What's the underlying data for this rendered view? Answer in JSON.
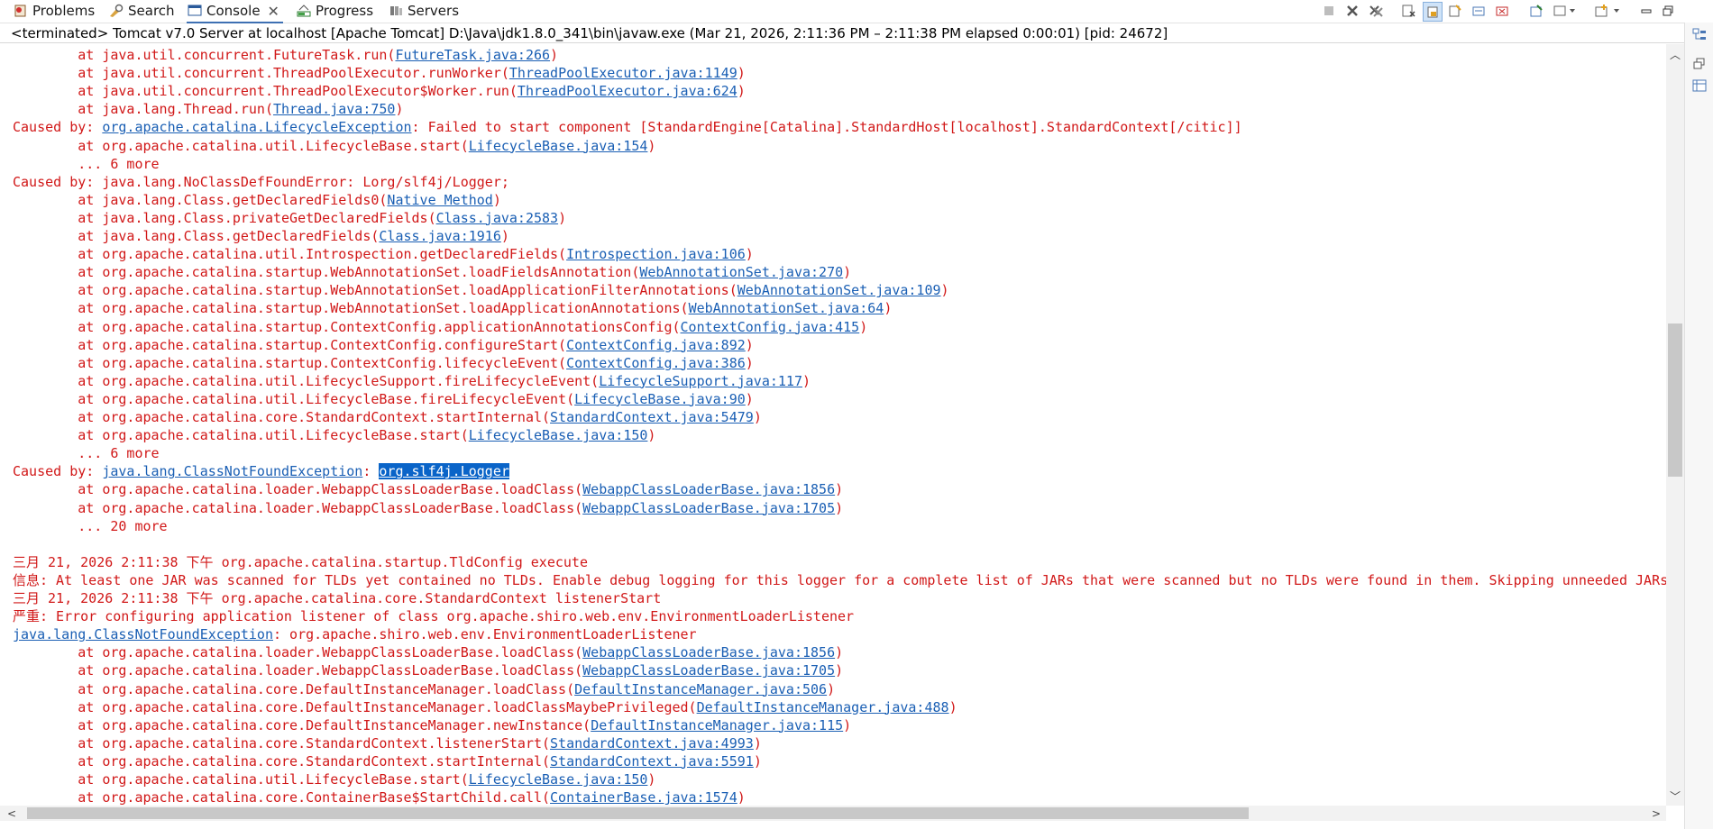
{
  "tabs": [
    {
      "label": "Problems",
      "icon": "problems-icon",
      "active": false
    },
    {
      "label": "Search",
      "icon": "search-icon",
      "active": false
    },
    {
      "label": "Console",
      "icon": "console-icon",
      "active": true
    },
    {
      "label": "Progress",
      "icon": "progress-icon",
      "active": false
    },
    {
      "label": "Servers",
      "icon": "servers-icon",
      "active": false
    }
  ],
  "status": "<terminated> Tomcat v7.0 Server at localhost [Apache Tomcat] D:\\Java\\jdk1.8.0_341\\bin\\javaw.exe  (Mar 21, 2026, 2:11:36 PM – 2:11:38 PM elapsed 0:00:01) [pid: 24672]",
  "colors": {
    "error_text": "#d11818",
    "link": "#1a5fb4",
    "selection": "#0a64c8"
  },
  "toolbar_icons": [
    "terminate-icon",
    "remove-launch-icon",
    "remove-all-icon",
    "clear-console-icon",
    "scroll-lock-icon",
    "word-wrap-icon",
    "show-stdout-icon",
    "show-stderr-icon",
    "pin-console-icon",
    "display-console-icon",
    "open-console-icon",
    "minimize-icon",
    "maximize-icon"
  ],
  "console_lines": [
    {
      "segments": [
        {
          "t": "        at java.util.concurrent.FutureTask.run("
        },
        {
          "t": "FutureTask.java:266",
          "link": true
        },
        {
          "t": ")"
        }
      ]
    },
    {
      "segments": [
        {
          "t": "        at java.util.concurrent.ThreadPoolExecutor.runWorker("
        },
        {
          "t": "ThreadPoolExecutor.java:1149",
          "link": true
        },
        {
          "t": ")"
        }
      ]
    },
    {
      "segments": [
        {
          "t": "        at java.util.concurrent.ThreadPoolExecutor$Worker.run("
        },
        {
          "t": "ThreadPoolExecutor.java:624",
          "link": true
        },
        {
          "t": ")"
        }
      ]
    },
    {
      "segments": [
        {
          "t": "        at java.lang.Thread.run("
        },
        {
          "t": "Thread.java:750",
          "link": true
        },
        {
          "t": ")"
        }
      ]
    },
    {
      "segments": [
        {
          "t": "Caused by: "
        },
        {
          "t": "org.apache.catalina.LifecycleException",
          "link": true
        },
        {
          "t": ": Failed to start component [StandardEngine[Catalina].StandardHost[localhost].StandardContext[/citic]]"
        }
      ]
    },
    {
      "segments": [
        {
          "t": "        at org.apache.catalina.util.LifecycleBase.start("
        },
        {
          "t": "LifecycleBase.java:154",
          "link": true
        },
        {
          "t": ")"
        }
      ]
    },
    {
      "segments": [
        {
          "t": "        ... 6 more"
        }
      ]
    },
    {
      "segments": [
        {
          "t": "Caused by: java.lang.NoClassDefFoundError: Lorg/slf4j/Logger;"
        }
      ]
    },
    {
      "segments": [
        {
          "t": "        at java.lang.Class.getDeclaredFields0("
        },
        {
          "t": "Native Method",
          "link": true
        },
        {
          "t": ")"
        }
      ]
    },
    {
      "segments": [
        {
          "t": "        at java.lang.Class.privateGetDeclaredFields("
        },
        {
          "t": "Class.java:2583",
          "link": true
        },
        {
          "t": ")"
        }
      ]
    },
    {
      "segments": [
        {
          "t": "        at java.lang.Class.getDeclaredFields("
        },
        {
          "t": "Class.java:1916",
          "link": true
        },
        {
          "t": ")"
        }
      ]
    },
    {
      "segments": [
        {
          "t": "        at org.apache.catalina.util.Introspection.getDeclaredFields("
        },
        {
          "t": "Introspection.java:106",
          "link": true
        },
        {
          "t": ")"
        }
      ]
    },
    {
      "segments": [
        {
          "t": "        at org.apache.catalina.startup.WebAnnotationSet.loadFieldsAnnotation("
        },
        {
          "t": "WebAnnotationSet.java:270",
          "link": true
        },
        {
          "t": ")"
        }
      ]
    },
    {
      "segments": [
        {
          "t": "        at org.apache.catalina.startup.WebAnnotationSet.loadApplicationFilterAnnotations("
        },
        {
          "t": "WebAnnotationSet.java:109",
          "link": true
        },
        {
          "t": ")"
        }
      ]
    },
    {
      "segments": [
        {
          "t": "        at org.apache.catalina.startup.WebAnnotationSet.loadApplicationAnnotations("
        },
        {
          "t": "WebAnnotationSet.java:64",
          "link": true
        },
        {
          "t": ")"
        }
      ]
    },
    {
      "segments": [
        {
          "t": "        at org.apache.catalina.startup.ContextConfig.applicationAnnotationsConfig("
        },
        {
          "t": "ContextConfig.java:415",
          "link": true
        },
        {
          "t": ")"
        }
      ]
    },
    {
      "segments": [
        {
          "t": "        at org.apache.catalina.startup.ContextConfig.configureStart("
        },
        {
          "t": "ContextConfig.java:892",
          "link": true
        },
        {
          "t": ")"
        }
      ]
    },
    {
      "segments": [
        {
          "t": "        at org.apache.catalina.startup.ContextConfig.lifecycleEvent("
        },
        {
          "t": "ContextConfig.java:386",
          "link": true
        },
        {
          "t": ")"
        }
      ]
    },
    {
      "segments": [
        {
          "t": "        at org.apache.catalina.util.LifecycleSupport.fireLifecycleEvent("
        },
        {
          "t": "LifecycleSupport.java:117",
          "link": true
        },
        {
          "t": ")"
        }
      ]
    },
    {
      "segments": [
        {
          "t": "        at org.apache.catalina.util.LifecycleBase.fireLifecycleEvent("
        },
        {
          "t": "LifecycleBase.java:90",
          "link": true
        },
        {
          "t": ")"
        }
      ]
    },
    {
      "segments": [
        {
          "t": "        at org.apache.catalina.core.StandardContext.startInternal("
        },
        {
          "t": "StandardContext.java:5479",
          "link": true
        },
        {
          "t": ")"
        }
      ]
    },
    {
      "segments": [
        {
          "t": "        at org.apache.catalina.util.LifecycleBase.start("
        },
        {
          "t": "LifecycleBase.java:150",
          "link": true
        },
        {
          "t": ")"
        }
      ]
    },
    {
      "segments": [
        {
          "t": "        ... 6 more"
        }
      ]
    },
    {
      "segments": [
        {
          "t": "Caused by: "
        },
        {
          "t": "java.lang.ClassNotFoundException",
          "link": true
        },
        {
          "t": ": "
        },
        {
          "t": "org.slf4j.Logger",
          "sel": true
        }
      ]
    },
    {
      "segments": [
        {
          "t": "        at org.apache.catalina.loader.WebappClassLoaderBase.loadClass("
        },
        {
          "t": "WebappClassLoaderBase.java:1856",
          "link": true
        },
        {
          "t": ")"
        }
      ]
    },
    {
      "segments": [
        {
          "t": "        at org.apache.catalina.loader.WebappClassLoaderBase.loadClass("
        },
        {
          "t": "WebappClassLoaderBase.java:1705",
          "link": true
        },
        {
          "t": ")"
        }
      ]
    },
    {
      "segments": [
        {
          "t": "        ... 20 more"
        }
      ]
    },
    {
      "segments": [
        {
          "t": ""
        }
      ]
    },
    {
      "segments": [
        {
          "t": "三月 21, 2026 2:11:38 下午 org.apache.catalina.startup.TldConfig execute"
        }
      ]
    },
    {
      "segments": [
        {
          "t": "信息: At least one JAR was scanned for TLDs yet contained no TLDs. Enable debug logging for this logger for a complete list of JARs that were scanned but no TLDs were found in them. Skipping unneeded JARs"
        }
      ]
    },
    {
      "segments": [
        {
          "t": "三月 21, 2026 2:11:38 下午 org.apache.catalina.core.StandardContext listenerStart"
        }
      ]
    },
    {
      "segments": [
        {
          "t": "严重: Error configuring application listener of class org.apache.shiro.web.env.EnvironmentLoaderListener"
        }
      ]
    },
    {
      "segments": [
        {
          "t": "java.lang.ClassNotFoundException",
          "link": true
        },
        {
          "t": ": org.apache.shiro.web.env.EnvironmentLoaderListener"
        }
      ]
    },
    {
      "segments": [
        {
          "t": "        at org.apache.catalina.loader.WebappClassLoaderBase.loadClass("
        },
        {
          "t": "WebappClassLoaderBase.java:1856",
          "link": true
        },
        {
          "t": ")"
        }
      ]
    },
    {
      "segments": [
        {
          "t": "        at org.apache.catalina.loader.WebappClassLoaderBase.loadClass("
        },
        {
          "t": "WebappClassLoaderBase.java:1705",
          "link": true
        },
        {
          "t": ")"
        }
      ]
    },
    {
      "segments": [
        {
          "t": "        at org.apache.catalina.core.DefaultInstanceManager.loadClass("
        },
        {
          "t": "DefaultInstanceManager.java:506",
          "link": true
        },
        {
          "t": ")"
        }
      ]
    },
    {
      "segments": [
        {
          "t": "        at org.apache.catalina.core.DefaultInstanceManager.loadClassMaybePrivileged("
        },
        {
          "t": "DefaultInstanceManager.java:488",
          "link": true
        },
        {
          "t": ")"
        }
      ]
    },
    {
      "segments": [
        {
          "t": "        at org.apache.catalina.core.DefaultInstanceManager.newInstance("
        },
        {
          "t": "DefaultInstanceManager.java:115",
          "link": true
        },
        {
          "t": ")"
        }
      ]
    },
    {
      "segments": [
        {
          "t": "        at org.apache.catalina.core.StandardContext.listenerStart("
        },
        {
          "t": "StandardContext.java:4993",
          "link": true
        },
        {
          "t": ")"
        }
      ]
    },
    {
      "segments": [
        {
          "t": "        at org.apache.catalina.core.StandardContext.startInternal("
        },
        {
          "t": "StandardContext.java:5591",
          "link": true
        },
        {
          "t": ")"
        }
      ]
    },
    {
      "segments": [
        {
          "t": "        at org.apache.catalina.util.LifecycleBase.start("
        },
        {
          "t": "LifecycleBase.java:150",
          "link": true
        },
        {
          "t": ")"
        }
      ]
    },
    {
      "segments": [
        {
          "t": "        at org.apache.catalina.core.ContainerBase$StartChild.call("
        },
        {
          "t": "ContainerBase.java:1574",
          "link": true
        },
        {
          "t": ")"
        }
      ]
    }
  ]
}
